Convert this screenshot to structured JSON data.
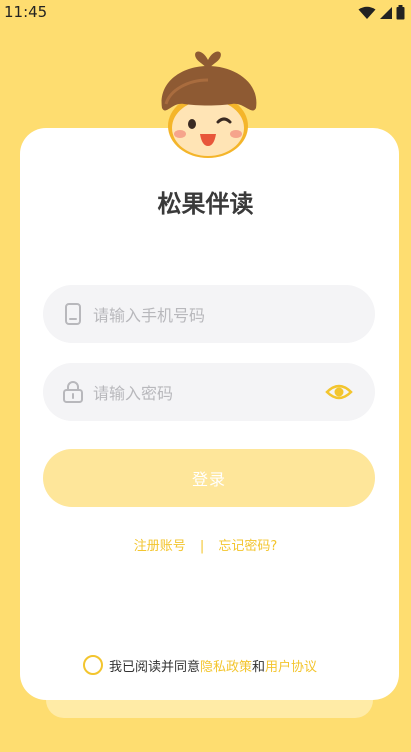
{
  "status": {
    "time": "11:45"
  },
  "app": {
    "title": "松果伴读"
  },
  "form": {
    "phone_placeholder": "请输入手机号码",
    "password_placeholder": "请输入密码",
    "login_label": "登录"
  },
  "links": {
    "register": "注册账号",
    "separator": "|",
    "forgot": "忘记密码?"
  },
  "agreement": {
    "prefix": "我已阅读并同意",
    "privacy": "隐私政策",
    "and": "和",
    "terms": "用户协议"
  },
  "colors": {
    "background": "#FEDD70",
    "accent": "#F3C52E",
    "button": "#FEE69A"
  },
  "icons": [
    "wifi-icon",
    "signal-icon",
    "battery-icon",
    "phone-icon",
    "lock-icon",
    "eye-icon",
    "radio-icon"
  ]
}
